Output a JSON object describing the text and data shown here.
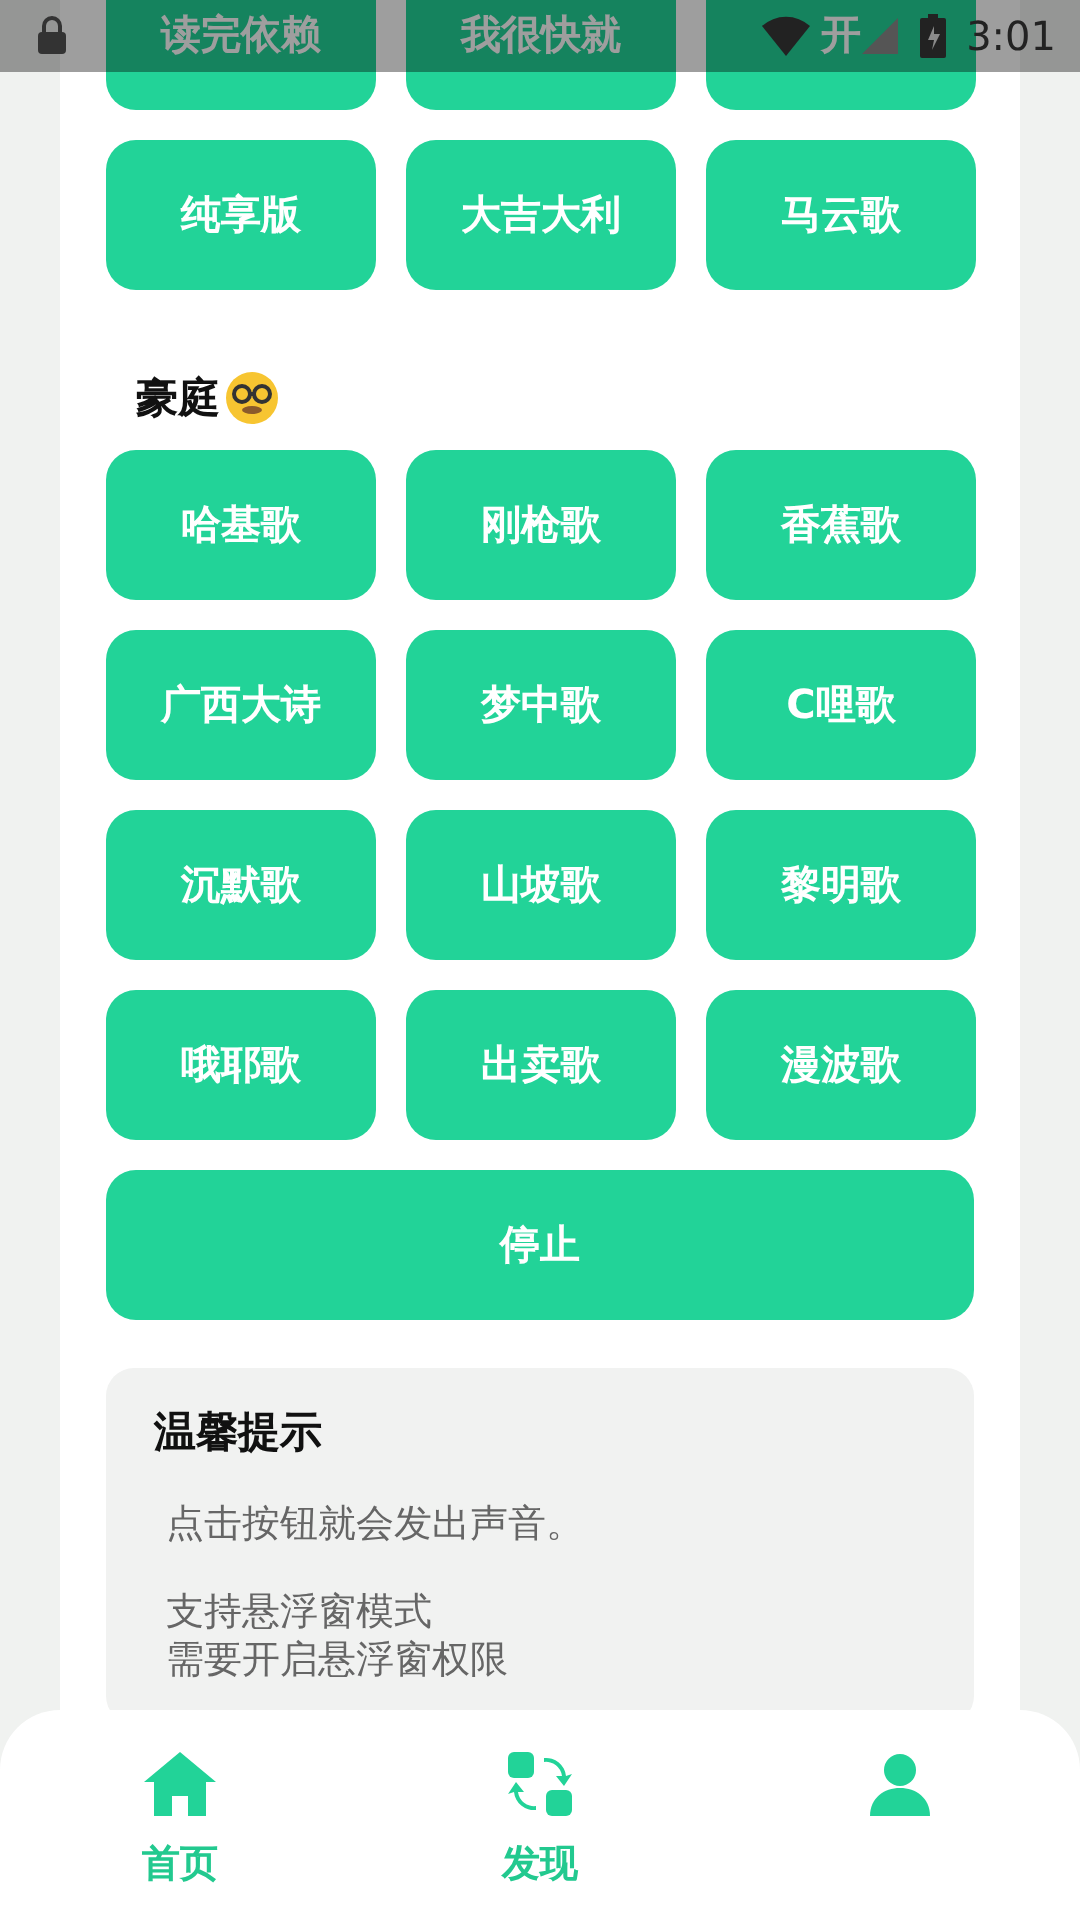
{
  "status_bar": {
    "time": "3:01"
  },
  "top_buttons": [
    "读完依赖",
    "我很快就",
    "开",
    "纯享版",
    "大吉大利",
    "马云歌"
  ],
  "section": {
    "title": "豪庭",
    "buttons": [
      "哈基歌",
      "刚枪歌",
      "香蕉歌",
      "广西大诗",
      "梦中歌",
      "C哩歌",
      "沉默歌",
      "山坡歌",
      "黎明歌",
      "哦耶歌",
      "出卖歌",
      "漫波歌"
    ]
  },
  "stop_button": "停止",
  "tips": {
    "title": "温馨提示",
    "paragraphs": [
      [
        "点击按钮就会发出声音。"
      ],
      [
        "支持悬浮窗模式",
        "需要开启悬浮窗权限"
      ]
    ]
  },
  "nav": [
    {
      "label": "首页"
    },
    {
      "label": "发现"
    }
  ]
}
